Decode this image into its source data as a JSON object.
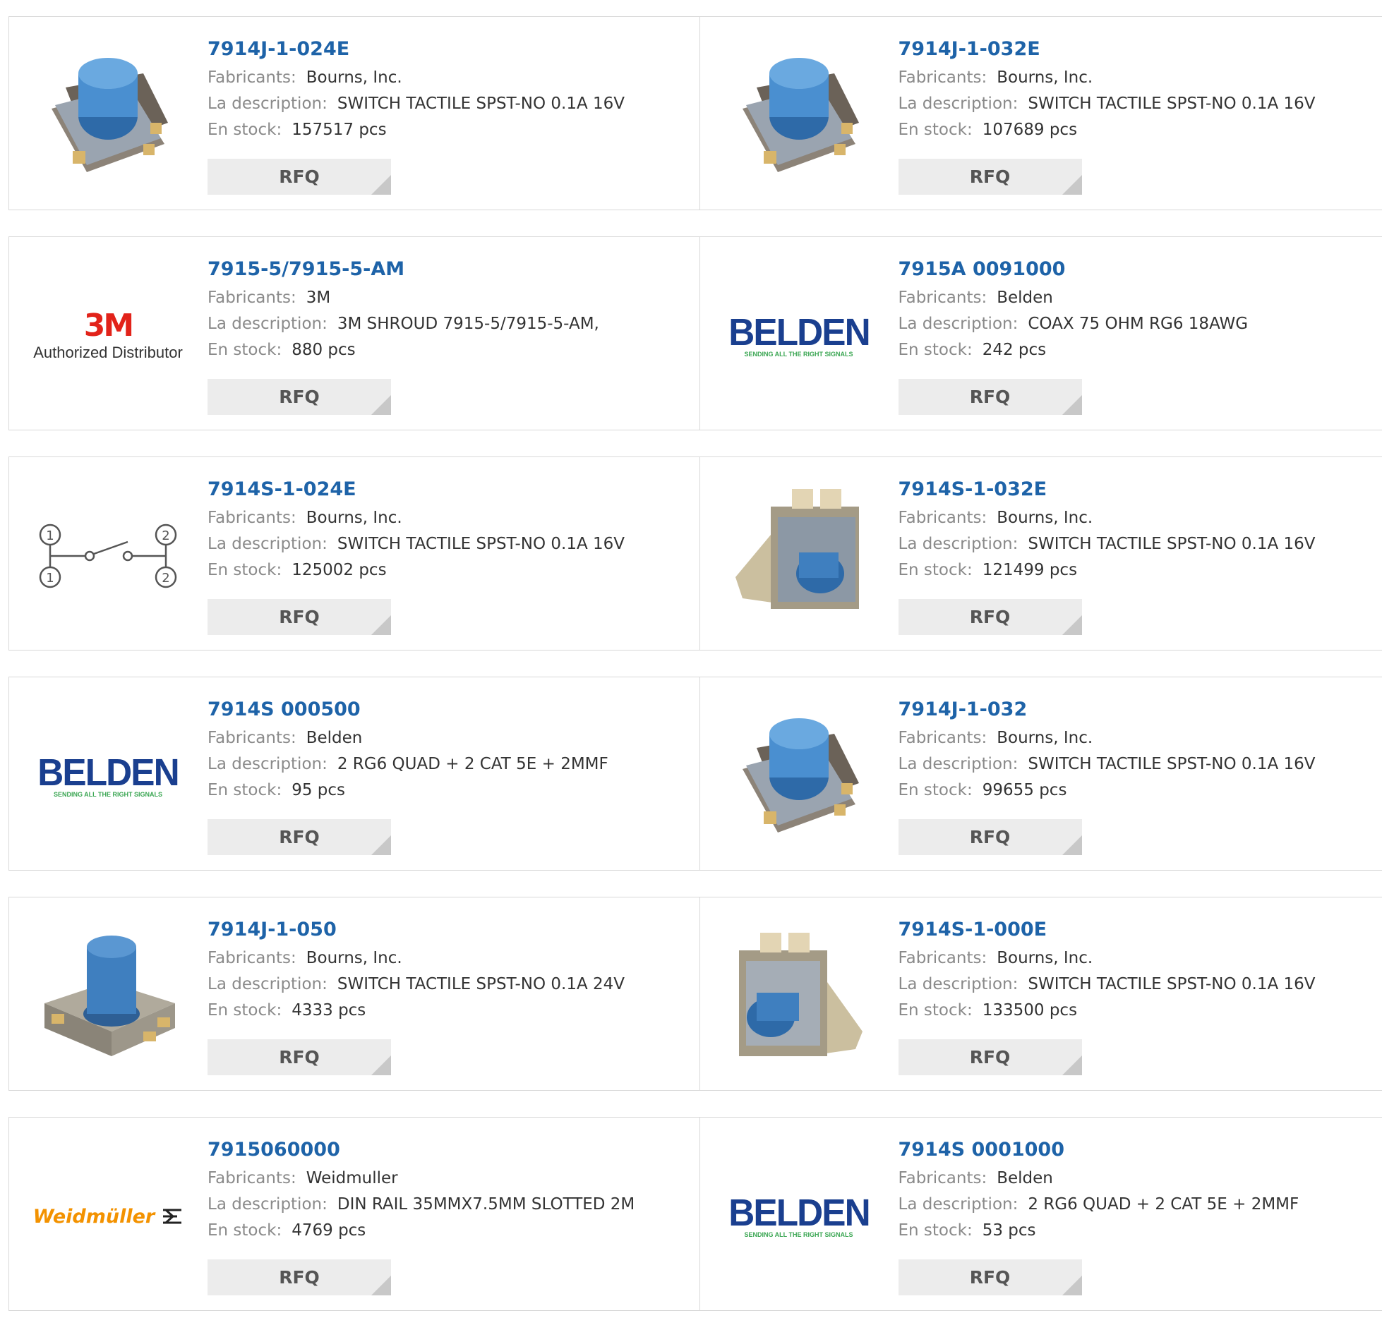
{
  "labels": {
    "manufacturer": "Fabricants:",
    "description": "La description:",
    "stock": "En stock:",
    "rfq": "RFQ"
  },
  "logos": {
    "three_m": "3M",
    "three_m_tag": "Authorized Distributor",
    "belden": "BELDEN",
    "belden_tag": "SENDING ALL THE RIGHT SIGNALS",
    "weidmuller": "Weidmüller"
  },
  "colors": {
    "part_link": "#1e63a8",
    "three_m_red": "#e2231a",
    "belden_blue": "#1a3f8f",
    "belden_green": "#3aa652",
    "weidmuller_orange": "#f39200",
    "switch_blue": "#4a8fd0"
  },
  "products": [
    {
      "part": "7914J-1-024E",
      "manufacturer": "Bourns, Inc.",
      "description": "SWITCH TACTILE SPST-NO 0.1A 16V",
      "stock": "157517 pcs",
      "image": "tactile-switch-image"
    },
    {
      "part": "7914J-1-032E",
      "manufacturer": "Bourns, Inc.",
      "description": "SWITCH TACTILE SPST-NO 0.1A 16V",
      "stock": "107689 pcs",
      "image": "tactile-switch-image"
    },
    {
      "part": "7915-5/7915-5-AM",
      "manufacturer": "3M",
      "description": "3M SHROUD 7915-5/7915-5-AM,",
      "stock": "880 pcs",
      "image": "3m-logo"
    },
    {
      "part": "7915A 0091000",
      "manufacturer": "Belden",
      "description": "COAX 75 OHM RG6 18AWG",
      "stock": "242 pcs",
      "image": "belden-logo"
    },
    {
      "part": "7914S-1-024E",
      "manufacturer": "Bourns, Inc.",
      "description": "SWITCH TACTILE SPST-NO 0.1A 16V",
      "stock": "125002 pcs",
      "image": "switch-schematic-diagram"
    },
    {
      "part": "7914S-1-032E",
      "manufacturer": "Bourns, Inc.",
      "description": "SWITCH TACTILE SPST-NO 0.1A 16V",
      "stock": "121499 pcs",
      "image": "side-switch-image"
    },
    {
      "part": "7914S 000500",
      "manufacturer": "Belden",
      "description": "2 RG6 QUAD + 2 CAT 5E + 2MMF",
      "stock": "95 pcs",
      "image": "belden-logo"
    },
    {
      "part": "7914J-1-032",
      "manufacturer": "Bourns, Inc.",
      "description": "SWITCH TACTILE SPST-NO 0.1A 16V",
      "stock": "99655 pcs",
      "image": "tactile-switch-image"
    },
    {
      "part": "7914J-1-050",
      "manufacturer": "Bourns, Inc.",
      "description": "SWITCH TACTILE SPST-NO 0.1A 24V",
      "stock": "4333 pcs",
      "image": "tall-switch-image"
    },
    {
      "part": "7914S-1-000E",
      "manufacturer": "Bourns, Inc.",
      "description": "SWITCH TACTILE SPST-NO 0.1A 16V",
      "stock": "133500 pcs",
      "image": "side-switch-image-flipped"
    },
    {
      "part": "7915060000",
      "manufacturer": "Weidmuller",
      "description": "DIN RAIL 35MMX7.5MM SLOTTED 2M",
      "stock": "4769 pcs",
      "image": "weidmuller-logo"
    },
    {
      "part": "7914S 0001000",
      "manufacturer": "Belden",
      "description": "2 RG6 QUAD + 2 CAT 5E + 2MMF",
      "stock": "53 pcs",
      "image": "belden-logo"
    }
  ]
}
